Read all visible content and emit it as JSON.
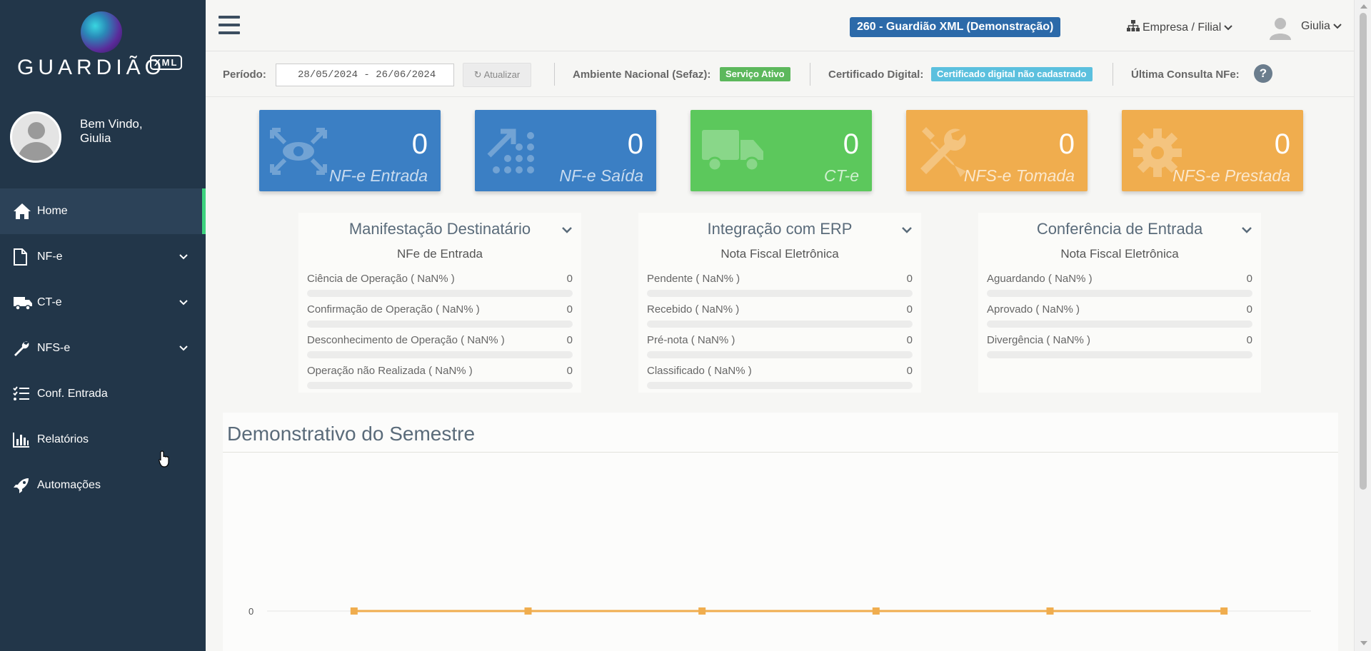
{
  "brand": {
    "wordmark": "GUARDIÃO",
    "tag": "XML"
  },
  "user": {
    "greeting": "Bem Vindo,",
    "name": "Giulia"
  },
  "nav": [
    {
      "label": "Home",
      "icon": "home-icon",
      "active": true
    },
    {
      "label": "NF-e",
      "icon": "file-icon",
      "expandable": true
    },
    {
      "label": "CT-e",
      "icon": "truck-icon",
      "expandable": true
    },
    {
      "label": "NFS-e",
      "icon": "wrench-icon",
      "expandable": true
    },
    {
      "label": "Conf. Entrada",
      "icon": "checklist-icon"
    },
    {
      "label": "Relatórios",
      "icon": "bar-chart-icon"
    },
    {
      "label": "Automações",
      "icon": "rocket-icon"
    }
  ],
  "topbar": {
    "company_badge": "260 - Guardião XML (Demonstração)",
    "empresa_label": "Empresa / Filial",
    "user_label": "Giulia"
  },
  "filters": {
    "period_label": "Período:",
    "period_value": "28/05/2024 - 26/06/2024",
    "refresh_label": "Atualizar",
    "ambiente_label": "Ambiente Nacional (Sefaz):",
    "ambiente_status": "Serviço Ativo",
    "cert_label": "Certificado Digital:",
    "cert_status": "Certificado digital não cadastrado",
    "ultima_label": "Última Consulta NFe:",
    "help_symbol": "?"
  },
  "tiles": [
    {
      "label": "NF-e Entrada",
      "value": "0",
      "color": "#3b7fc4",
      "icon": "eye-arrows-icon"
    },
    {
      "label": "NF-e Saída",
      "value": "0",
      "color": "#3b7fc4",
      "icon": "dots-arrow-icon"
    },
    {
      "label": "CT-e",
      "value": "0",
      "color": "#5cc85c",
      "icon": "truck-icon"
    },
    {
      "label": "NFS-e Tomada",
      "value": "0",
      "color": "#f0ad4e",
      "icon": "tools-icon"
    },
    {
      "label": "NFS-e Prestada",
      "value": "0",
      "color": "#f0ad4e",
      "icon": "gear-icon"
    }
  ],
  "panels": [
    {
      "title": "Manifestação Destinatário",
      "subtitle": "NFe de Entrada",
      "rows": [
        {
          "label": "Ciência de Operação ( NaN% )",
          "value": "0"
        },
        {
          "label": "Confirmação de Operação ( NaN% )",
          "value": "0"
        },
        {
          "label": "Desconhecimento de Operação ( NaN% )",
          "value": "0"
        },
        {
          "label": "Operação não Realizada ( NaN% )",
          "value": "0"
        }
      ]
    },
    {
      "title": "Integração com ERP",
      "subtitle": "Nota Fiscal Eletrônica",
      "rows": [
        {
          "label": "Pendente ( NaN% )",
          "value": "0"
        },
        {
          "label": "Recebido ( NaN% )",
          "value": "0"
        },
        {
          "label": "Pré-nota ( NaN% )",
          "value": "0"
        },
        {
          "label": "Classificado ( NaN% )",
          "value": "0"
        }
      ]
    },
    {
      "title": "Conferência de Entrada",
      "subtitle": "Nota Fiscal Eletrônica",
      "rows": [
        {
          "label": "Aguardando ( NaN% )",
          "value": "0"
        },
        {
          "label": "Aprovado ( NaN% )",
          "value": "0"
        },
        {
          "label": "Divergência ( NaN% )",
          "value": "0"
        }
      ]
    }
  ],
  "semester": {
    "title": "Demonstrativo do Semestre",
    "chart_data": {
      "type": "line",
      "x": [
        1,
        2,
        3,
        4,
        5,
        6
      ],
      "series": [
        {
          "values": [
            0,
            0,
            0,
            0,
            0,
            0
          ],
          "color": "#f0ad4e"
        }
      ],
      "yticks": [
        "0"
      ],
      "grid": true
    }
  }
}
